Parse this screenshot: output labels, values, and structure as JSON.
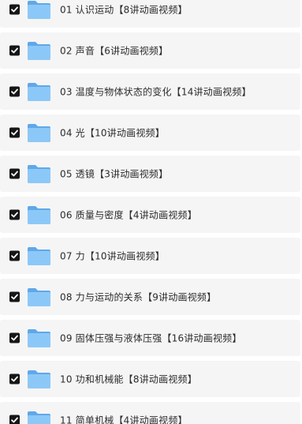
{
  "icon": "folder-icon",
  "items": [
    {
      "label": "01 认识运动【8讲动画视频】",
      "checked": true
    },
    {
      "label": "02 声音【6讲动画视频】",
      "checked": true
    },
    {
      "label": "03 温度与物体状态的变化【14讲动画视频】",
      "checked": true
    },
    {
      "label": "04 光【10讲动画视频】",
      "checked": true
    },
    {
      "label": "05 透镜【3讲动画视频】",
      "checked": true
    },
    {
      "label": "06 质量与密度【4讲动画视频】",
      "checked": true
    },
    {
      "label": "07 力【10讲动画视频】",
      "checked": true
    },
    {
      "label": "08 力与运动的关系【9讲动画视频】",
      "checked": true
    },
    {
      "label": "09 固体压强与液体压强【16讲动画视频】",
      "checked": true
    },
    {
      "label": "10 功和机械能【8讲动画视频】",
      "checked": true
    },
    {
      "label": "11 简单机械【4讲动画视频】",
      "checked": true
    }
  ]
}
